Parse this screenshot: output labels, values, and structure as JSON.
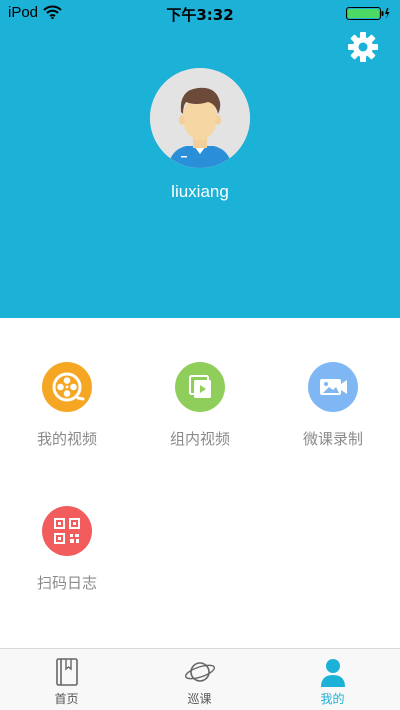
{
  "status_bar": {
    "carrier": "iPod",
    "time": "下午3:32",
    "wifi_icon": "wifi-icon",
    "battery_icon": "battery-charging-icon"
  },
  "header": {
    "background_color": "#1cb1d6",
    "settings_icon": "gear-icon",
    "avatar_icon": "user-avatar",
    "username": "liuxiang"
  },
  "menu": {
    "items": [
      {
        "label": "我的视频",
        "icon": "film-reel-icon",
        "color": "#f5a623"
      },
      {
        "label": "组内视频",
        "icon": "video-stack-icon",
        "color": "#8fce5a"
      },
      {
        "label": "微课录制",
        "icon": "video-camera-icon",
        "color": "#7fb7f5"
      },
      {
        "label": "扫码日志",
        "icon": "qr-code-icon",
        "color": "#f25c5c"
      }
    ]
  },
  "tabbar": {
    "active_color": "#1cb1d6",
    "tabs": [
      {
        "label": "首页",
        "icon": "book-icon",
        "active": false
      },
      {
        "label": "巡课",
        "icon": "planet-icon",
        "active": false
      },
      {
        "label": "我的",
        "icon": "person-icon",
        "active": true
      }
    ]
  }
}
